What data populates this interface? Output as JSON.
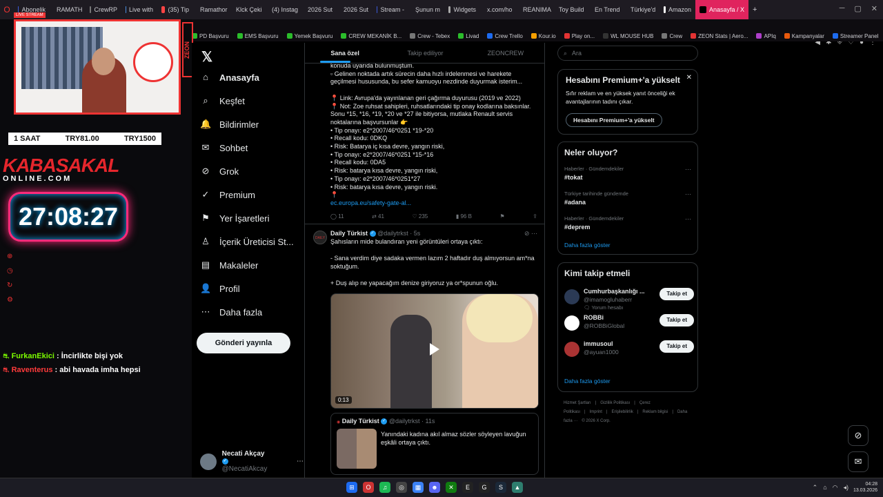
{
  "browser": {
    "tabs": [
      {
        "label": "Abonelik",
        "color": "#3b5bdb"
      },
      {
        "label": "RAMATH",
        "color": "#2bbd2b"
      },
      {
        "label": "CrewRP",
        "color": "#777777"
      },
      {
        "label": "Live with",
        "color": "#4a90e2"
      },
      {
        "label": "(35) Tip",
        "color": "#ff4444"
      },
      {
        "label": "Ramathor",
        "color": "#777777"
      },
      {
        "label": "Klck Çeki",
        "color": "#aaaaaa"
      },
      {
        "label": "(4) Instag",
        "color": "#d6249f"
      },
      {
        "label": "2026 Sut",
        "color": "#aaaaaa"
      },
      {
        "label": "2026 Sut",
        "color": "#aaaaaa"
      },
      {
        "label": "Stream -",
        "color": "#3b5bdb"
      },
      {
        "label": "Şunun m",
        "color": "#aaaaaa"
      },
      {
        "label": "Widgets",
        "color": "#aaaaaa"
      },
      {
        "label": "x.com/ho",
        "color": "#ffffff"
      },
      {
        "label": "REANIMA",
        "color": "#aaaaaa"
      },
      {
        "label": "Toy Build",
        "color": "#e33333"
      },
      {
        "label": "En Trend",
        "color": "#e8590c"
      },
      {
        "label": "Türkiye'd",
        "color": "#e8590c"
      },
      {
        "label": "Amazon",
        "color": "#ffffff"
      },
      {
        "label": "Anasayfa / X",
        "color": "#000000",
        "active": true
      }
    ],
    "bookmarks": [
      {
        "label": "PD Başvuru",
        "color": "#2bbd2b"
      },
      {
        "label": "EMS Başvuru",
        "color": "#2bbd2b"
      },
      {
        "label": "Yemek Başvuru",
        "color": "#2bbd2b"
      },
      {
        "label": "CREW MEKANİK B...",
        "color": "#2bbd2b"
      },
      {
        "label": "Crew - Tebex",
        "color": "#777777"
      },
      {
        "label": "Livad",
        "color": "#2bbd2b"
      },
      {
        "label": "Crew Trello",
        "color": "#1d6bf0"
      },
      {
        "label": "Kour.io",
        "color": "#f59f00"
      },
      {
        "label": "Play on...",
        "color": "#e33333"
      },
      {
        "label": "WL MOUSE HUB",
        "color": "#333333"
      },
      {
        "label": "Crew",
        "color": "#777777"
      },
      {
        "label": "ZEON Stats | Aero...",
        "color": "#e33333"
      },
      {
        "label": "APIq",
        "color": "#ae3ec9"
      },
      {
        "label": "Kampanyalar",
        "color": "#e8590c"
      },
      {
        "label": "Streamer Panel",
        "color": "#1d6bf0"
      }
    ]
  },
  "overlay": {
    "live_badge": "LIVE STREAM",
    "zeon": "ZEON",
    "timer_row": {
      "a": "1 SAAT",
      "b": "TRY81.00",
      "c": "TRY1500"
    },
    "brand": "KABASAKAL",
    "brand_sub": "ONLINE.COM",
    "clock": "27:08:27",
    "chat": [
      {
        "user": "FurkanEkici",
        "msg": " : İncirlikte bişi yok"
      },
      {
        "user": "Raventerus",
        "msg": " : abi havada imha hepsi"
      }
    ]
  },
  "nav": {
    "logo": "𝕏",
    "items": [
      {
        "label": "Anasayfa",
        "icon": "home-icon",
        "glyph": "⌂",
        "active": true
      },
      {
        "label": "Keşfet",
        "icon": "search-icon",
        "glyph": "⌕"
      },
      {
        "label": "Bildirimler",
        "icon": "bell-icon",
        "glyph": "🔔"
      },
      {
        "label": "Sohbet",
        "icon": "mail-icon",
        "glyph": "✉"
      },
      {
        "label": "Grok",
        "icon": "grok-icon",
        "glyph": "⊘"
      },
      {
        "label": "Premium",
        "icon": "premium-icon",
        "glyph": "✓"
      },
      {
        "label": "Yer İşaretleri",
        "icon": "bookmark-icon",
        "glyph": "⚑"
      },
      {
        "label": "İçerik Üreticisi St...",
        "icon": "creator-icon",
        "glyph": "♙"
      },
      {
        "label": "Makaleler",
        "icon": "article-icon",
        "glyph": "▤"
      },
      {
        "label": "Profil",
        "icon": "profile-icon",
        "glyph": "👤"
      },
      {
        "label": "Daha fazla",
        "icon": "more-icon",
        "glyph": "⋯"
      }
    ],
    "post_button": "Gönderi yayınla",
    "account": {
      "name": "Necati Akçay",
      "handle": "@NecatiAkcay"
    }
  },
  "feed": {
    "tabs": [
      "Sana özel",
      "Takip ediliyor",
      "ZEONCREW"
    ],
    "tweet1_lines": [
      "konuda uyarıda bulunmuştum.",
      "   ▫ Gelinen noktada artık sürecin daha hızlı irdelenmesi ve harekete",
      "geçilmesi hususunda, bu sefer kamuoyu nezdinde duyurmak isterim...",
      "",
      "📍 Link: Avrupa'da yayınlanan geri çağırma duyurusu (2019 ve 2022)",
      "📍 Not: Zoe ruhsat sahipleri, ruhsatlarındaki tip onay kodlarına baksınlar.",
      "Sonu *15, *16, *19, *20 ve *27 ile bitiyorsa, mutlaka Renault servis",
      "noktalarına başvursunlar 👉",
      "• Tip onayı: e2*2007/46*0251 *19-*20",
      "• Recall kodu: 0DKQ",
      "• Risk: Batarya iç kısa devre, yangın riski,",
      "• Tip onayı: e2*2007/46*0251 *15-*16",
      "• Recall kodu: 0DA5",
      "• Risk: batarya kısa devre, yangın riski,",
      "• Tip onayı: e2*2007/46*0251*27",
      "• Risk: batarya kısa devre, yangın riski.",
      "📍"
    ],
    "tweet1_link": "ec.europa.eu/safety-gate-al...",
    "tweet1_actions": {
      "reply": "11",
      "retweet": "41",
      "like": "235",
      "views": "96 B"
    },
    "tweet2": {
      "name": "Daily Türkist",
      "handle": "@dailytrkst",
      "time": "· 5s",
      "avatar_text": "DAILY",
      "lines": [
        "Şahısların mide bulandıran yeni görüntüleri ortaya çıktı:",
        "",
        "- Sana verdim diye sadaka vermen lazım 2 haftadır duş almıyorsun am*na",
        "soktuğum.",
        "",
        "+ Duş alıp ne yapacağım denize giriyoruz ya or*spunun oğlu."
      ],
      "video_duration": "0:13"
    },
    "quote": {
      "name": "Daily Türkist",
      "handle": "@dailytrkst",
      "time": "· 11s",
      "text": "Yanındaki kadına akıl almaz sözler söyleyen lavuğun eşkâli ortaya çıktı."
    }
  },
  "right": {
    "search_placeholder": "Ara",
    "premium": {
      "title": "Hesabını Premium+'a yükselt",
      "desc": "Sıfır reklam ve en yüksek yanıt önceliği ek avantajlarının tadını çıkar.",
      "button": "Hesabını Premium+'a yükselt",
      "close": "✕"
    },
    "trends": {
      "title": "Neler oluyor?",
      "items": [
        {
          "cat": "Haberler · Gündemdekiler",
          "tag": "#tokat"
        },
        {
          "cat": "Türkiye tarihinde gündemde",
          "tag": "#adana"
        },
        {
          "cat": "Haberler · Gündemdekiler",
          "tag": "#deprem"
        }
      ],
      "more": "Daha fazla göster"
    },
    "follow": {
      "title": "Kimi takip etmeli",
      "users": [
        {
          "name": "Cumhurbaşkanlığı ...",
          "handle": "@imamogluhaberr",
          "hint": "🗨 Yorum hesabı",
          "btn": "Takip et"
        },
        {
          "name": "ROBBi",
          "handle": "@ROBBiGlobal",
          "hint": "",
          "btn": "Takip et"
        },
        {
          "name": "immusoul",
          "handle": "@ayuan1000",
          "hint": "",
          "btn": "Takip et"
        }
      ],
      "more": "Daha fazla göster"
    },
    "footer": [
      "Hizmet Şartları",
      "|",
      "Gizlilik Politikası",
      "|",
      "Çerez Politikası",
      "|",
      "Imprint",
      "|",
      "Erişilebilirlik",
      "|",
      "Reklam bilgisi",
      "|",
      "Daha fazla ···",
      "© 2026 X Corp."
    ]
  },
  "taskbar": {
    "time": "04:28",
    "date": "13.03.2026"
  }
}
